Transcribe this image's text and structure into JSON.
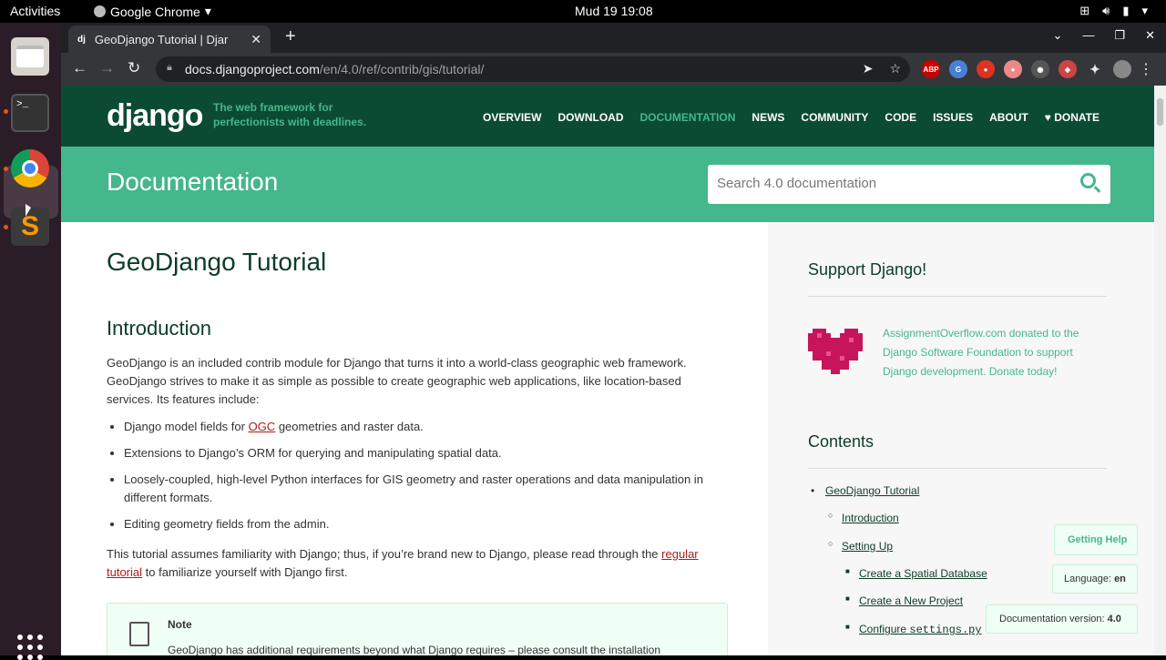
{
  "os": {
    "activities": "Activities",
    "app_name": "Google Chrome",
    "clock": "Mud 19  19:08"
  },
  "browser": {
    "tab_title": "GeoDjango Tutorial | Djar",
    "tab_favicon": "dj",
    "url_host": "docs.djangoproject.com",
    "url_path": "/en/4.0/ref/contrib/gis/tutorial/"
  },
  "site": {
    "logo": "django",
    "tagline": "The web framework for perfectionists with deadlines.",
    "nav": [
      "OVERVIEW",
      "DOWNLOAD",
      "DOCUMENTATION",
      "NEWS",
      "COMMUNITY",
      "CODE",
      "ISSUES",
      "ABOUT",
      "♥ DONATE"
    ],
    "nav_active": "DOCUMENTATION",
    "banner_title": "Documentation",
    "search_placeholder": "Search 4.0 documentation"
  },
  "main": {
    "title": "GeoDjango Tutorial",
    "section": "Introduction",
    "intro": "GeoDjango is an included contrib module for Django that turns it into a world-class geographic web framework. GeoDjango strives to make it as simple as possible to create geographic web applications, like location-based services. Its features include:",
    "features": {
      "f1_pre": "Django model fields for ",
      "f1_link": "OGC",
      "f1_post": " geometries and raster data.",
      "f2": "Extensions to Django’s ORM for querying and manipulating spatial data.",
      "f3": "Loosely-coupled, high-level Python interfaces for GIS geometry and raster operations and data manipulation in different formats.",
      "f4": "Editing geometry fields from the admin."
    },
    "p2_pre": "This tutorial assumes familiarity with Django; thus, if you’re brand new to Django, please read through the ",
    "p2_link": "regular tutorial",
    "p2_post": " to familiarize yourself with Django first.",
    "note_title": "Note",
    "note_text": "GeoDjango has additional requirements beyond what Django requires – please consult the installation"
  },
  "sidebar": {
    "support_title": "Support Django!",
    "donation": "AssignmentOverflow.com donated to the Django Software Foundation to support Django development. Donate today!",
    "contents_title": "Contents",
    "toc": {
      "l1": "GeoDjango Tutorial",
      "l2a": "Introduction",
      "l2b": "Setting Up",
      "l3a": "Create a Spatial Database",
      "l3b": "Create a New Project",
      "l3c_pre": "Configure ",
      "l3c_code": "settings.py"
    }
  },
  "floating": {
    "help": "Getting Help",
    "lang_label": "Language:",
    "lang_value": "en",
    "ver_label": "Documentation version:",
    "ver_value": "4.0"
  }
}
